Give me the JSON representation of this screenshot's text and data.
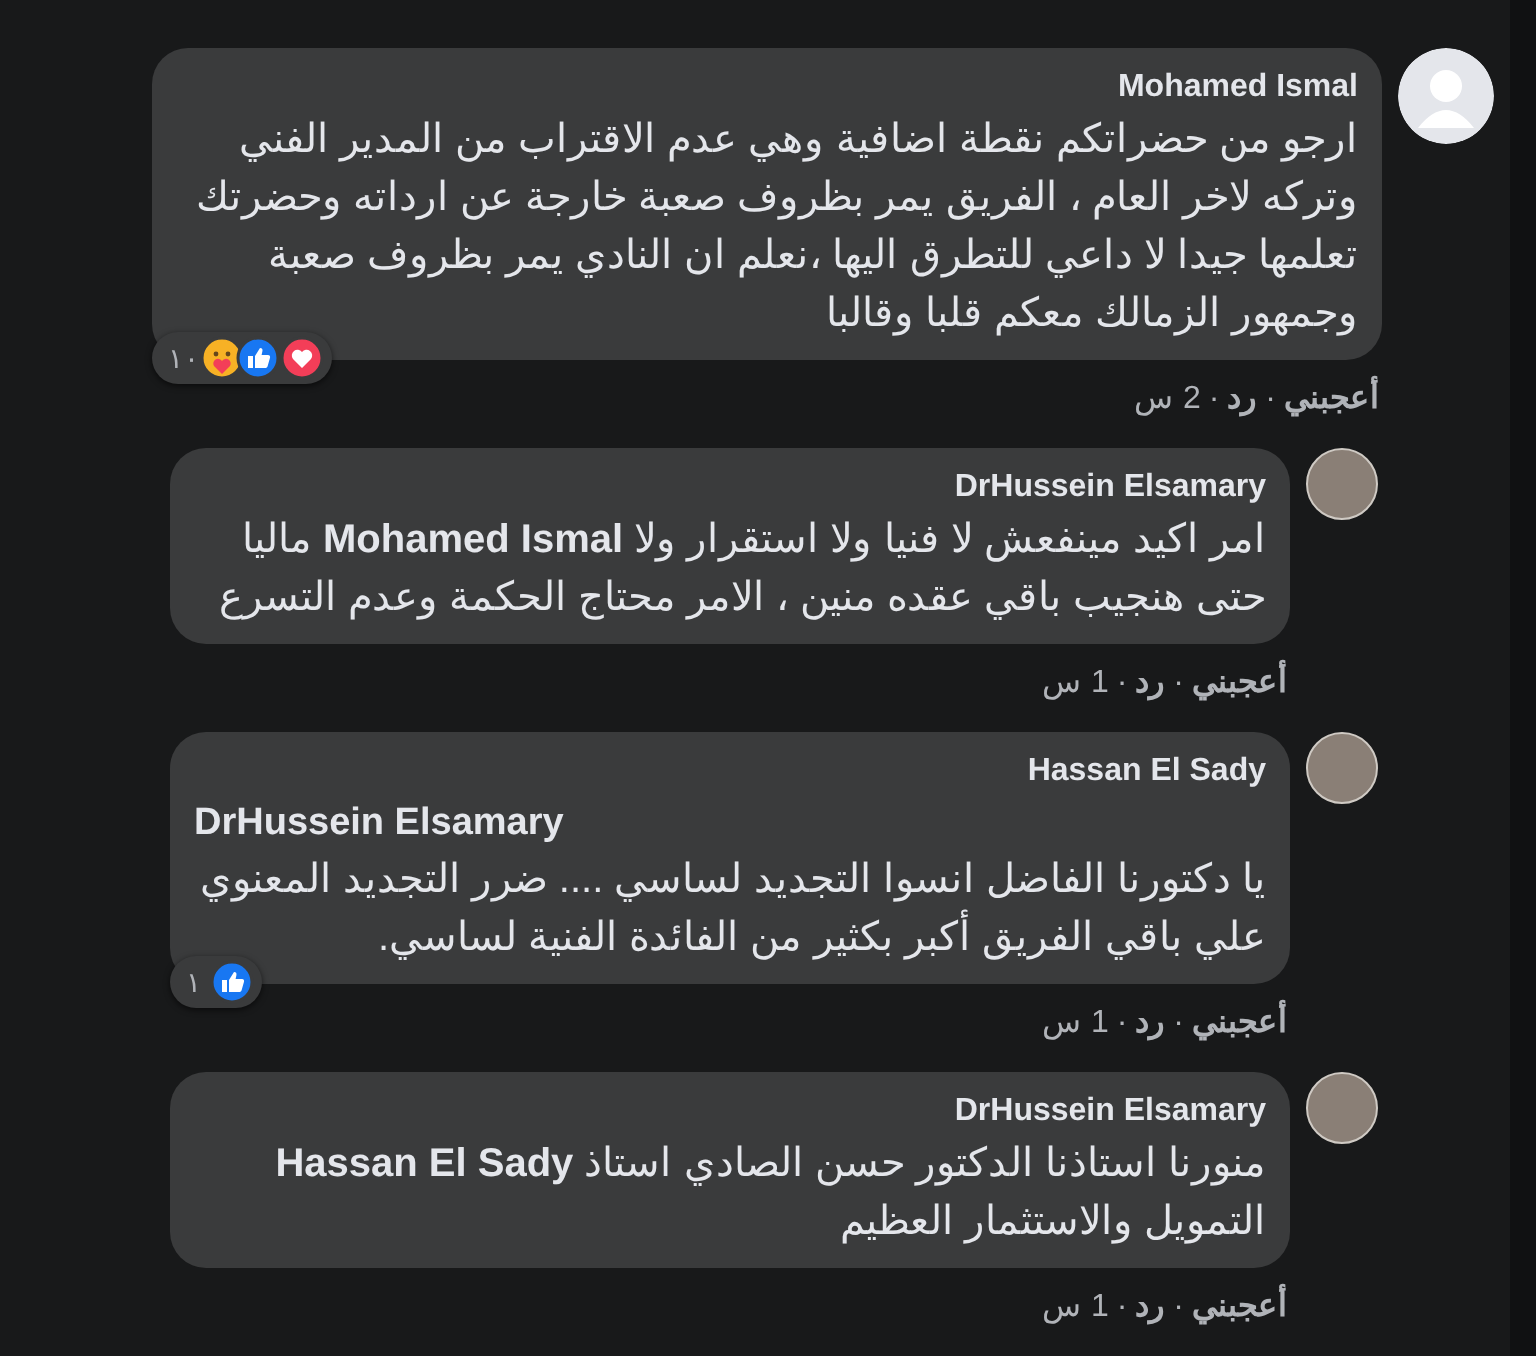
{
  "comments": [
    {
      "author": "Mohamed Ismal",
      "avatar": {
        "kind": "silhouette"
      },
      "text": "ارجو من حضراتكم نقطة اضافية وهي عدم الاقتراب من المدير الفني وتركه لاخر العام ، الفريق يمر بظروف صعبة خارجة عن ارداته وحضرتك تعلمها جيدا لا داعي للتطرق اليها ،نعلم ان النادي يمر بظروف صعبة وجمهور الزمالك معكم قلبا وقالبا",
      "reactions": {
        "count": "١٠",
        "icons": [
          {
            "kind": "love"
          },
          {
            "kind": "like"
          },
          {
            "kind": "care"
          }
        ]
      },
      "actions": {
        "like": "أعجبني",
        "reply": "رد",
        "separator": "·",
        "time": "2 س"
      },
      "replies": [
        {
          "author": "DrHussein Elsamary",
          "avatar": {
            "kind": "photo"
          },
          "text": "امر اكيد مينفعش لا فنيا ولا استقرار ولا **Mohamed Ismal** ماليا حتى هنجيب باقي عقده منين ، الامر محتاج الحكمة وعدم التسرع",
          "actions": {
            "like": "أعجبني",
            "reply": "رد",
            "separator": "·",
            "time": "1 س"
          }
        },
        {
          "author": "Hassan El Sady",
          "avatar": {
            "kind": "photo"
          },
          "mention": "DrHussein Elsamary",
          "text": "يا دكتورنا الفاضل انسوا التجديد لساسي .... ضرر التجديد المعنوي علي باقي الفريق أكبر بكثير من الفائدة الفنية لساسي.",
          "reactions": {
            "count": "١",
            "icons": [
              {
                "kind": "like"
              }
            ]
          },
          "actions": {
            "like": "أعجبني",
            "reply": "رد",
            "separator": "·",
            "time": "1 س"
          }
        },
        {
          "author": "DrHussein Elsamary",
          "avatar": {
            "kind": "photo"
          },
          "text": "منورنا استاذنا الدكتور حسن الصادي استاذ **Hassan El Sady** التمويل والاستثمار العظيم",
          "actions": {
            "like": "أعجبني",
            "reply": "رد",
            "separator": "·",
            "time": "1 س"
          }
        }
      ]
    }
  ]
}
